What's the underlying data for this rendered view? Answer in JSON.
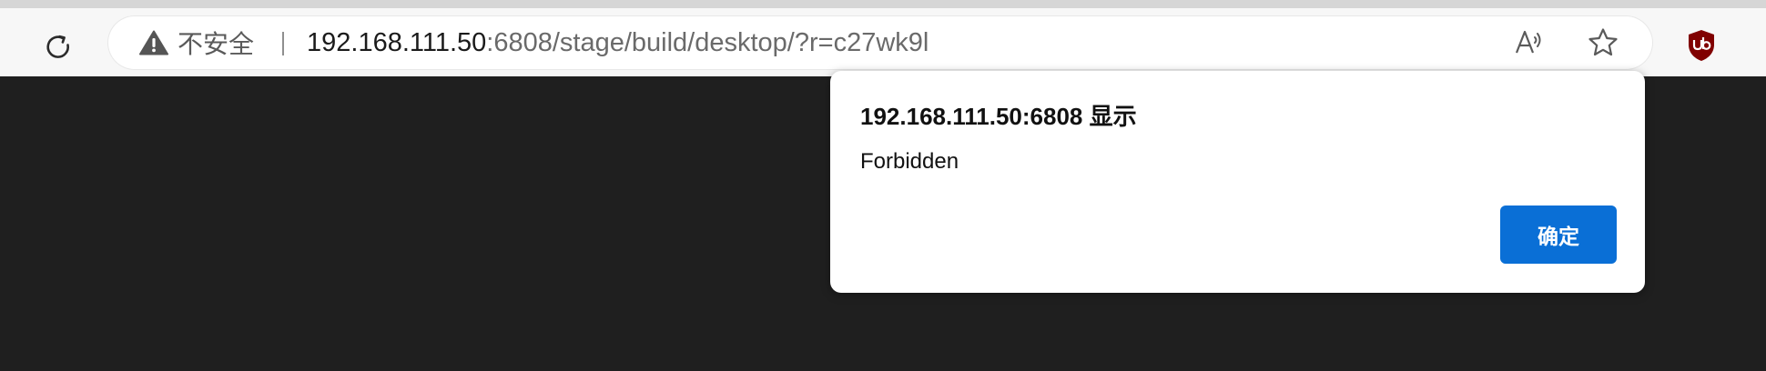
{
  "browser": {
    "address_bar": {
      "security_label": "不安全",
      "url_host": "192.168.111.50",
      "url_rest": ":6808/stage/build/desktop/?r=c27wk9l"
    },
    "icons": {
      "reload": "reload-icon",
      "warning": "warning-icon",
      "read_aloud": "read-aloud-icon",
      "favorite": "star-icon",
      "extension": "ublock-origin-icon"
    }
  },
  "page": {
    "background_color": "#1f1f1f"
  },
  "dialog": {
    "title": "192.168.111.50:6808 显示",
    "message": "Forbidden",
    "confirm_label": "确定",
    "accent_color": "#0a6fd6"
  }
}
